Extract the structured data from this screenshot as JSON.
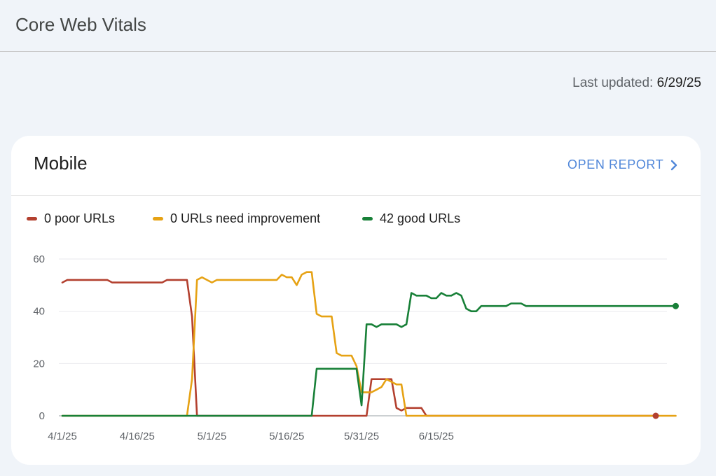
{
  "header": {
    "title": "Core Web Vitals"
  },
  "status": {
    "last_updated_label": "Last updated: ",
    "last_updated_date": "6/29/25"
  },
  "card": {
    "title": "Mobile",
    "open_report_label": "OPEN REPORT"
  },
  "legend": [
    {
      "label": "0 poor URLs",
      "color": "#b3402f"
    },
    {
      "label": "0 URLs need improvement",
      "color": "#e6a214"
    },
    {
      "label": "42 good URLs",
      "color": "#188038"
    }
  ],
  "chart_data": {
    "type": "line",
    "ylim": [
      0,
      60
    ],
    "y_ticks": [
      0,
      20,
      40,
      60
    ],
    "x_ticks": [
      "4/1/25",
      "4/16/25",
      "5/1/25",
      "5/16/25",
      "5/31/25",
      "6/15/25"
    ],
    "grid": true,
    "x_start": "4/1/25",
    "series": [
      {
        "name": "0 poor URLs",
        "color": "#b3402f",
        "values": [
          51,
          52,
          52,
          52,
          52,
          52,
          52,
          52,
          52,
          52,
          51,
          51,
          51,
          51,
          51,
          51,
          51,
          51,
          51,
          51,
          51,
          52,
          52,
          52,
          52,
          52,
          38,
          0,
          0,
          0,
          0,
          0,
          0,
          0,
          0,
          0,
          0,
          0,
          0,
          0,
          0,
          0,
          0,
          0,
          0,
          0,
          0,
          0,
          0,
          0,
          0,
          0,
          0,
          0,
          0,
          0,
          0,
          0,
          0,
          0,
          0,
          0,
          14,
          14,
          14,
          14,
          14,
          3,
          2,
          3,
          3,
          3,
          3,
          0,
          0,
          0,
          0,
          0,
          0,
          0,
          0,
          0,
          0,
          0,
          0,
          0,
          0,
          0,
          0,
          0,
          0,
          0,
          0,
          0,
          0,
          0,
          0,
          0,
          0,
          0,
          0,
          0,
          0,
          0,
          0,
          0,
          0,
          0,
          0,
          0,
          0,
          0,
          0,
          0,
          0,
          0,
          0,
          0,
          0,
          0
        ]
      },
      {
        "name": "0 URLs need improvement",
        "color": "#e6a214",
        "values": [
          0,
          0,
          0,
          0,
          0,
          0,
          0,
          0,
          0,
          0,
          0,
          0,
          0,
          0,
          0,
          0,
          0,
          0,
          0,
          0,
          0,
          0,
          0,
          0,
          0,
          0,
          14,
          52,
          53,
          52,
          51,
          52,
          52,
          52,
          52,
          52,
          52,
          52,
          52,
          52,
          52,
          52,
          52,
          52,
          54,
          53,
          53,
          50,
          54,
          55,
          55,
          39,
          38,
          38,
          38,
          24,
          23,
          23,
          23,
          19,
          9,
          9,
          9,
          10,
          11,
          14,
          13,
          12,
          12,
          0,
          0,
          0,
          0,
          0,
          0,
          0,
          0,
          0,
          0,
          0,
          0,
          0,
          0,
          0,
          0,
          0,
          0,
          0,
          0,
          0,
          0,
          0,
          0,
          0,
          0,
          0,
          0,
          0,
          0,
          0,
          0,
          0,
          0,
          0,
          0,
          0,
          0,
          0,
          0,
          0,
          0,
          0,
          0,
          0,
          0,
          0,
          0,
          0,
          0,
          0,
          0,
          0,
          0,
          0
        ]
      },
      {
        "name": "42 good URLs",
        "color": "#188038",
        "values": [
          0,
          0,
          0,
          0,
          0,
          0,
          0,
          0,
          0,
          0,
          0,
          0,
          0,
          0,
          0,
          0,
          0,
          0,
          0,
          0,
          0,
          0,
          0,
          0,
          0,
          0,
          0,
          0,
          0,
          0,
          0,
          0,
          0,
          0,
          0,
          0,
          0,
          0,
          0,
          0,
          0,
          0,
          0,
          0,
          0,
          0,
          0,
          0,
          0,
          0,
          0,
          18,
          18,
          18,
          18,
          18,
          18,
          18,
          18,
          18,
          4,
          35,
          35,
          34,
          35,
          35,
          35,
          35,
          34,
          35,
          47,
          46,
          46,
          46,
          45,
          45,
          47,
          46,
          46,
          47,
          46,
          41,
          40,
          40,
          42,
          42,
          42,
          42,
          42,
          42,
          43,
          43,
          43,
          42,
          42,
          42,
          42,
          42,
          42,
          42,
          42,
          42,
          42,
          42,
          42,
          42,
          42,
          42,
          42,
          42,
          42,
          42,
          42,
          42,
          42,
          42,
          42,
          42,
          42,
          42,
          42,
          42,
          42,
          42
        ]
      }
    ]
  }
}
